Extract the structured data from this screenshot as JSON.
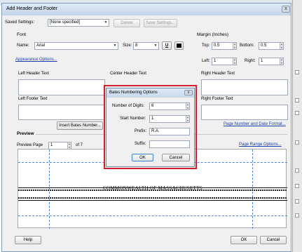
{
  "dialog": {
    "title": "Add Header and Footer",
    "close_glyph": "x",
    "saved_settings_label": "Saved Settings:",
    "saved_settings_value": "[None specified]",
    "delete_label": "Delete",
    "save_settings_label": "Save Settings...",
    "font": {
      "section_label": "Font",
      "name_label": "Name:",
      "name_value": "Arial",
      "size_label": "Size:",
      "size_value": "8",
      "underline_glyph": "U",
      "appearance_link": "Appearance Options..."
    },
    "margin": {
      "section_label": "Margin (Inches)",
      "top_label": "Top:",
      "top_value": "0.5",
      "bottom_label": "Bottom:",
      "bottom_value": "0.5",
      "left_label": "Left:",
      "left_value": "1",
      "right_label": "Right:",
      "right_value": "1"
    },
    "header_footer": {
      "left_header": "Left Header Text",
      "center_header": "Center Header Text",
      "right_header": "Right Header Text",
      "left_footer": "Left Footer Text",
      "right_footer": "Right Footer Text",
      "insert_bates_label": "Insert Bates Number...",
      "page_number_link": "Page Number and Date Format..."
    },
    "preview": {
      "section_label": "Preview",
      "page_label": "Preview Page",
      "page_value": "1",
      "of_label": "of 7",
      "page_range_link": "Page Range Options...",
      "document_text": "COMMONWEALTH OF MASSACHUSETTS"
    },
    "help_label": "Help",
    "ok_label": "OK",
    "cancel_label": "Cancel"
  },
  "bates_popup": {
    "title": "Bates Numbering Options",
    "close_glyph": "x",
    "digits_label": "Number of Digits:",
    "digits_value": "6",
    "start_label": "Start Number:",
    "start_value": "1",
    "prefix_label": "Prefix:",
    "prefix_value": "R.A.",
    "suffix_label": "Suffix:",
    "suffix_value": "",
    "ok_label": "OK",
    "cancel_label": "Cancel",
    "highlight_color": "#d11f2f"
  }
}
